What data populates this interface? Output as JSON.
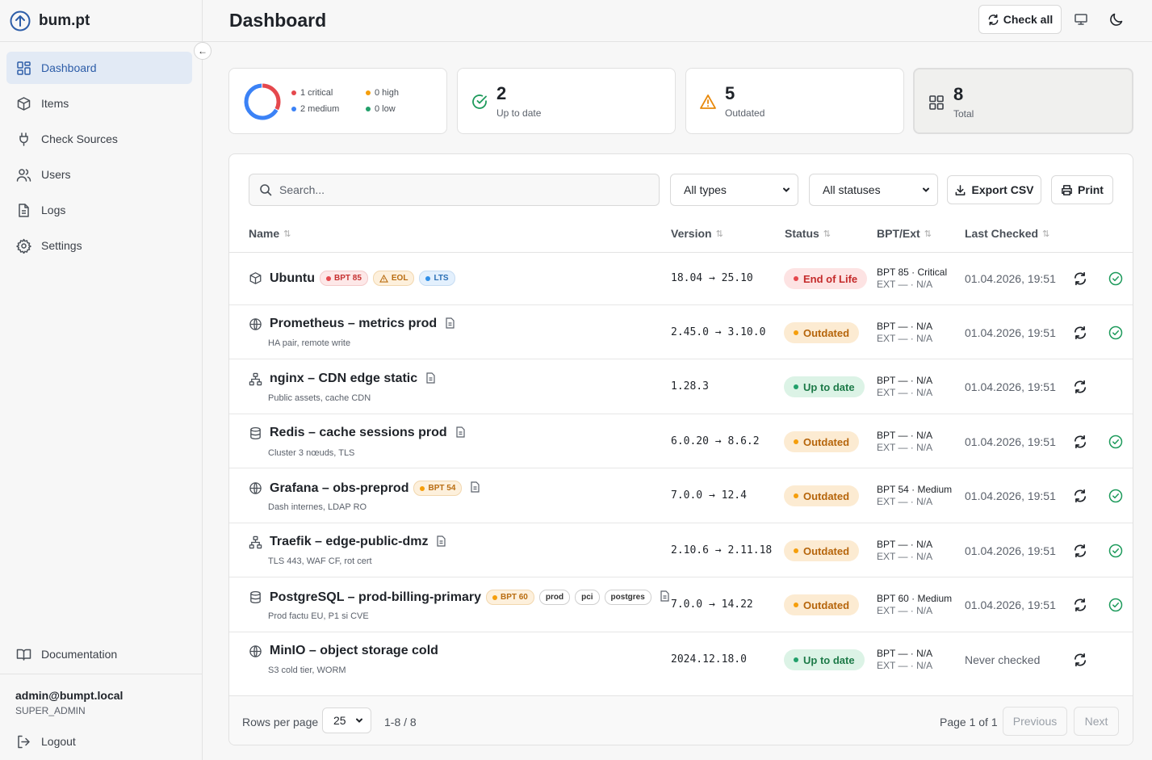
{
  "brand": {
    "name": "bum.pt"
  },
  "sidebar": {
    "collapse_icon": "←",
    "items": [
      {
        "label": "Dashboard",
        "icon": "dashboard-icon"
      },
      {
        "label": "Items",
        "icon": "box-icon"
      },
      {
        "label": "Check Sources",
        "icon": "plug-icon"
      },
      {
        "label": "Users",
        "icon": "users-icon"
      },
      {
        "label": "Logs",
        "icon": "file-icon"
      },
      {
        "label": "Settings",
        "icon": "gear-icon"
      }
    ],
    "documentation": "Documentation",
    "user": {
      "email": "admin@bumpt.local",
      "role": "SUPER_ADMIN"
    },
    "logout": "Logout"
  },
  "header": {
    "title": "Dashboard",
    "check_all": "Check all"
  },
  "stats": {
    "legend": {
      "critical": "1 critical",
      "high": "0 high",
      "medium": "2 medium",
      "low": "0 low"
    },
    "severity_counts": {
      "critical": 1,
      "high": 0,
      "medium": 2,
      "low": 0
    },
    "up_to_date": {
      "value": "2",
      "label": "Up to date"
    },
    "outdated": {
      "value": "5",
      "label": "Outdated"
    },
    "total": {
      "value": "8",
      "label": "Total"
    }
  },
  "colors": {
    "critical": "#e5484d",
    "high": "#f59e0b",
    "medium": "#3b82f6",
    "low": "#22a06b",
    "accent": "#2d5da8"
  },
  "toolbar": {
    "search_placeholder": "Search...",
    "type_filter": "All types",
    "status_filter": "All statuses",
    "export": "Export CSV",
    "print": "Print"
  },
  "table": {
    "headers": {
      "name": "Name",
      "version": "Version",
      "status": "Status",
      "bpt": "BPT/Ext",
      "checked": "Last Checked",
      "sort_glyph": "⇅"
    },
    "rows": [
      {
        "name": "Ubuntu",
        "subtitle": "",
        "icon": "box-icon",
        "tags": [
          "BPT 85",
          "EOL",
          "LTS"
        ],
        "version": "18.04 → 25.10",
        "status": "End of Life",
        "bpt": "BPT 85 · Critical",
        "ext": "EXT — · N/A",
        "checked": "01.04.2026, 19:51"
      },
      {
        "name": "Prometheus – metrics prod",
        "subtitle": "HA pair, remote write",
        "icon": "globe-icon",
        "tags": [],
        "version": "2.45.0 → 3.10.0",
        "status": "Outdated",
        "bpt": "BPT — · N/A",
        "ext": "EXT — · N/A",
        "checked": "01.04.2026, 19:51"
      },
      {
        "name": "nginx – CDN edge static",
        "subtitle": "Public assets, cache CDN",
        "icon": "network-icon",
        "tags": [],
        "version": "1.28.3",
        "status": "Up to date",
        "bpt": "BPT — · N/A",
        "ext": "EXT — · N/A",
        "checked": "01.04.2026, 19:51"
      },
      {
        "name": "Redis – cache sessions prod",
        "subtitle": "Cluster 3 nœuds, TLS",
        "icon": "database-icon",
        "tags": [],
        "version": "6.0.20 → 8.6.2",
        "status": "Outdated",
        "bpt": "BPT — · N/A",
        "ext": "EXT — · N/A",
        "checked": "01.04.2026, 19:51"
      },
      {
        "name": "Grafana – obs-preprod",
        "subtitle": "Dash internes, LDAP RO",
        "icon": "globe-icon",
        "tags": [
          "BPT 54"
        ],
        "version": "7.0.0 → 12.4",
        "status": "Outdated",
        "bpt": "BPT 54 · Medium",
        "ext": "EXT — · N/A",
        "checked": "01.04.2026, 19:51"
      },
      {
        "name": "Traefik – edge-public-dmz",
        "subtitle": "TLS 443, WAF CF, rot cert",
        "icon": "network-icon",
        "tags": [],
        "version": "2.10.6 → 2.11.18",
        "status": "Outdated",
        "bpt": "BPT — · N/A",
        "ext": "EXT — · N/A",
        "checked": "01.04.2026, 19:51"
      },
      {
        "name": "PostgreSQL – prod-billing-primary",
        "subtitle": "Prod factu EU, P1 si CVE",
        "icon": "database-icon",
        "tags": [
          "BPT 60",
          "prod",
          "pci",
          "postgres"
        ],
        "version": "7.0.0 → 14.22",
        "status": "Outdated",
        "bpt": "BPT 60 · Medium",
        "ext": "EXT — · N/A",
        "checked": "01.04.2026, 19:51"
      },
      {
        "name": "MinIO – object storage cold",
        "subtitle": "S3 cold tier, WORM",
        "icon": "globe-icon",
        "tags": [],
        "version": "2024.12.18.0",
        "status": "Up to date",
        "bpt": "BPT — · N/A",
        "ext": "EXT — · N/A",
        "checked": "Never checked"
      }
    ]
  },
  "footer": {
    "rows_per_page_label": "Rows per page",
    "rows_per_page": "25",
    "range": "1-8 / 8",
    "page_info": "Page 1 of 1",
    "previous": "Previous",
    "next": "Next"
  }
}
